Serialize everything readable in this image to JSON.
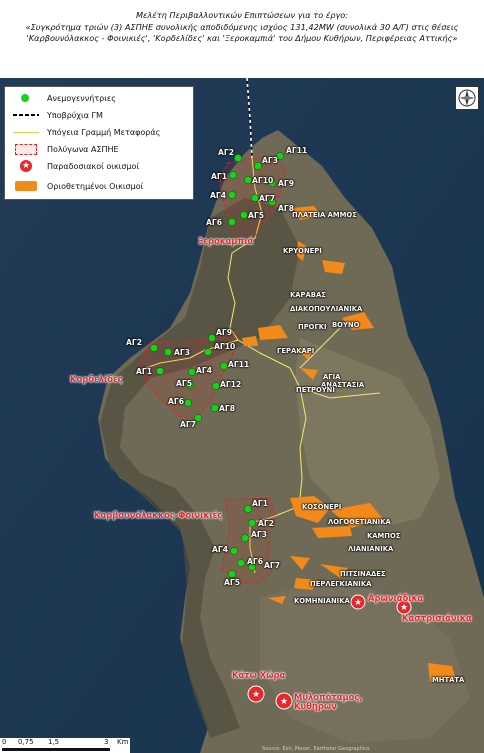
{
  "title": {
    "line1": "Μελέτη Περιβαλλοντικών Επιπτώσεων για το έργο:",
    "line2": "«Συγκρότημα τριών (3) ΑΣΠΗΕ συνολικής αποδιδόμενης ισχύος 131,42MW (συνολικά 30 Α/Γ) στις θέσεις",
    "line3": "'Καρβουνόλακκος - Φοινικιές', 'Κορδελίδες' και 'Ξεροκαμπιά' του Δήμου Κυθήρων, Περιφέρειας Αττικής»"
  },
  "legend": {
    "items": [
      {
        "label": "Ανεμογεννήτριες"
      },
      {
        "label": "Υποβρύχια ΓΜ"
      },
      {
        "label": "Υπόγεια Γραμμή Μεταφοράς"
      },
      {
        "label": "Πολύγωνα ΑΣΠΗΕ"
      },
      {
        "label": "Παραδοσιακοί οικισμοί"
      },
      {
        "label": "Οριοθετημένοι Οικισμοί"
      }
    ]
  },
  "colors": {
    "turbine": "#19d219",
    "cable": "#f2e96a",
    "polygon": "#d9262c",
    "settlement": "#f28a1a",
    "traditional": "#e8262c"
  },
  "sites": {
    "xerokampia": "Ξεροκαμπιά",
    "kordelides": "Κορδελίδες",
    "karvounolakkos": "Καρβουνόλακκος-Φοινικιές"
  },
  "turbines": {
    "north": [
      "ΑΓ2",
      "ΑΓ3",
      "ΑΓ11",
      "ΑΓ1",
      "ΑΓ10",
      "ΑΓ9",
      "ΑΓ4",
      "ΑΓ7",
      "ΑΓ8",
      "ΑΓ5",
      "ΑΓ6"
    ],
    "middle": [
      "ΑΓ2",
      "ΑΓ3",
      "ΑΓ9",
      "ΑΓ10",
      "ΑΓ1",
      "ΑΓ4",
      "ΑΓ11",
      "ΑΓ5",
      "ΑΓ12",
      "ΑΓ6",
      "ΑΓ8",
      "ΑΓ7"
    ],
    "south": [
      "ΑΓ1",
      "ΑΓ2",
      "ΑΓ3",
      "ΑΓ4",
      "ΑΓ6",
      "ΑΓ7",
      "ΑΓ5"
    ]
  },
  "settlements": [
    "ΠΛΑΤΕΙΑ ΑΜΜΟΣ",
    "ΚΡΥΟΝΕΡΙ",
    "ΚΑΡΑΒΑΣ",
    "ΔΙΑΚΟΠΟΥΛΙΑΝΙΚΑ",
    "ΒΟΥΝΟ",
    "ΠΡΟΓΚΙ",
    "ΓΕΡΑΚΑΡΙ",
    "ΑΓΙΑ",
    "ΑΝΑΣΤΑΣΙΑ",
    "ΠΕΤΡΟΥΝΙ",
    "ΚΟΣΟΝΕΡΙ",
    "ΛΟΓΟΘΕΤΙΑΝΙΚΑ",
    "ΚΑΜΠΟΣ",
    "ΛΙΑΝΙΑΝΙΚΑ",
    "ΠΙΤΣΙΝΑΔΕΣ",
    "ΠΕΡΛΕΓΚΙΑΝΙΚΑ",
    "ΚΟΜΗΝΙΑΝΙΚΑ",
    "ΜΗΤΑΤΑ"
  ],
  "traditional_villages": [
    "Αρωνιάδικα",
    "Καστρισιάνικα",
    "Κάτω Χώρα",
    "Μυλοπόταμος,",
    "Κυθήρων"
  ],
  "scale": {
    "labels": [
      "0",
      "0,75",
      "1,5",
      "3"
    ],
    "unit": "Km"
  },
  "credit": "Source: Esri, Maxar, Earthstar Geographics"
}
